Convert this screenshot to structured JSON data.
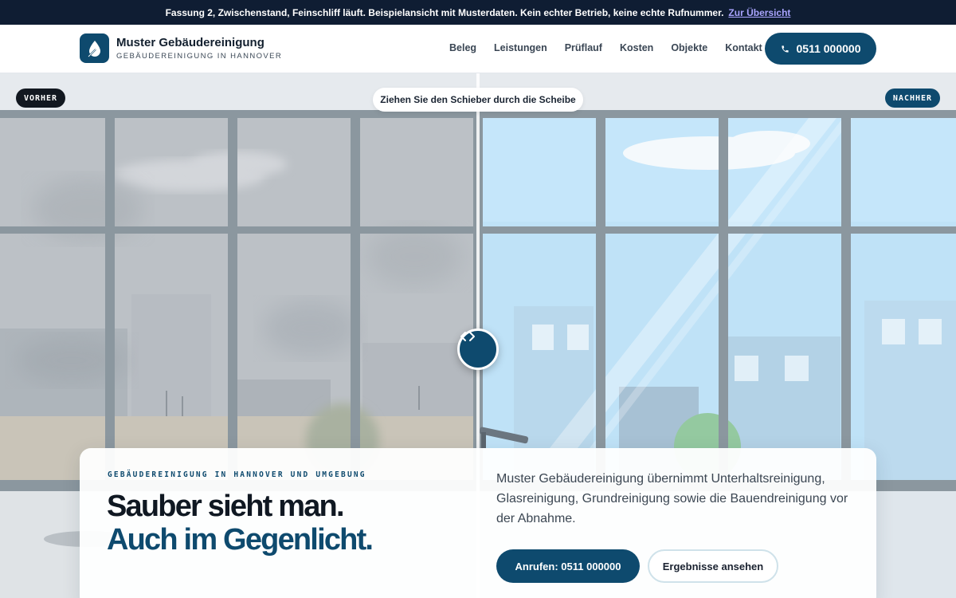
{
  "notice": {
    "text": "Fassung 2, Zwischenstand, Feinschliff läuft. Beispielansicht mit Musterdaten. Kein echter Betrieb, keine echte Rufnummer.",
    "link": "Zur Übersicht"
  },
  "header": {
    "brand_name": "Muster Gebäudereinigung",
    "brand_tagline": "GEBÄUDEREINIGUNG IN HANNOVER",
    "nav": [
      "Beleg",
      "Leistungen",
      "Prüflauf",
      "Kosten",
      "Objekte",
      "Kontakt"
    ],
    "phone": "0511 000000"
  },
  "comparison": {
    "before_label": "VORHER",
    "after_label": "NACHHER",
    "hint": "Ziehen Sie den Schieber durch die Scheibe",
    "slider_position": 0.5
  },
  "hero": {
    "eyebrow": "GEBÄUDEREINIGUNG IN HANNOVER UND UMGEBUNG",
    "headline_1": "Sauber sieht man.",
    "headline_2": "Auch im Gegenlicht.",
    "lead": "Muster Gebäudereinigung übernimmt Unterhaltsreinigung, Glasreinigung, Grundreinigung sowie die Bauendreinigung vor der Abnahme.",
    "cta_primary": "Anrufen: 0511 000000",
    "cta_secondary": "Ergebnisse ansehen"
  },
  "colors": {
    "brand": "#0e4a6e",
    "notice_bg": "#0f1d33",
    "notice_link": "#a9a4ff",
    "before_tint": "#bcc1c6",
    "after_sky": "#bfe2f7"
  },
  "icons": {
    "logo": "water-drop-icon",
    "phone": "phone-icon",
    "handle": "chevrons-left-right-icon"
  }
}
